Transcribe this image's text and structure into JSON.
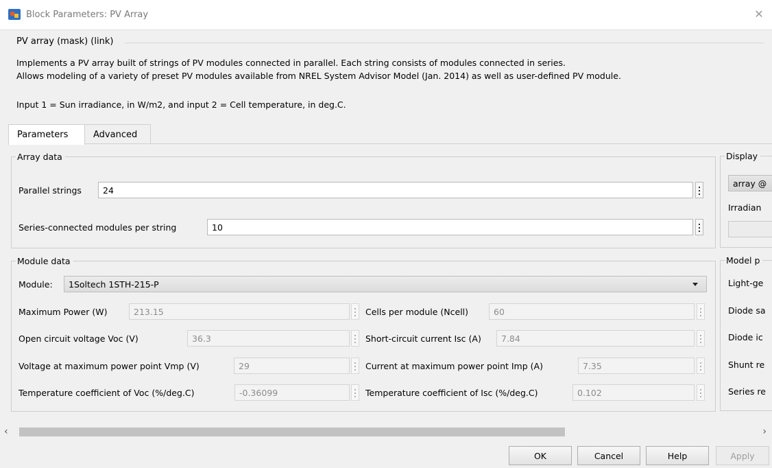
{
  "window": {
    "title": "Block Parameters: PV Array",
    "close_glyph": "✕"
  },
  "header": {
    "mask_type": "PV array (mask) (link)",
    "description_lines": [
      "Implements a PV array built of strings of PV modules connected in parallel. Each string consists of modules connected in series.",
      "Allows modeling of a variety of preset PV modules available from NREL System Advisor Model (Jan. 2014) as well as user-defined PV module.",
      "Input 1 = Sun irradiance, in W/m2, and input 2 = Cell temperature, in deg.C."
    ]
  },
  "tabs": [
    {
      "label": "Parameters",
      "active": true
    },
    {
      "label": "Advanced",
      "active": false
    }
  ],
  "array_data": {
    "title": "Array data",
    "parallel_strings": {
      "label": "Parallel strings",
      "value": "24"
    },
    "series_modules": {
      "label": "Series-connected modules per string",
      "value": "10"
    }
  },
  "module_data": {
    "title": "Module data",
    "module_label": "Module:",
    "module_value": "1Soltech 1STH-215-P",
    "left": [
      {
        "label": "Maximum Power (W)",
        "value": "213.15"
      },
      {
        "label": "Open circuit voltage  Voc (V)",
        "value": "36.3"
      },
      {
        "label": "Voltage at maximum power point Vmp (V)",
        "value": "29"
      },
      {
        "label": "Temperature coefficient of Voc (%/deg.C)",
        "value": "-0.36099"
      }
    ],
    "right": [
      {
        "label": "Cells per module (Ncell)",
        "value": "60"
      },
      {
        "label": "Short-circuit current Isc (A)",
        "value": "7.84"
      },
      {
        "label": "Current at maximum power point Imp (A)",
        "value": "7.35"
      },
      {
        "label": "Temperature coefficient of Isc (%/deg.C)",
        "value": "0.102"
      }
    ]
  },
  "display": {
    "title": "Display",
    "selected": "array @",
    "irradiance_label": "Irradian"
  },
  "model_params": {
    "title": "Model p",
    "labels": [
      "Light-ge",
      "Diode sa",
      "Diode ic",
      "Shunt re",
      "Series re"
    ]
  },
  "scrollbar": {
    "left_arrow": "‹",
    "right_arrow": "›"
  },
  "buttons": {
    "ok": "OK",
    "cancel": "Cancel",
    "help": "Help",
    "apply": "Apply"
  }
}
